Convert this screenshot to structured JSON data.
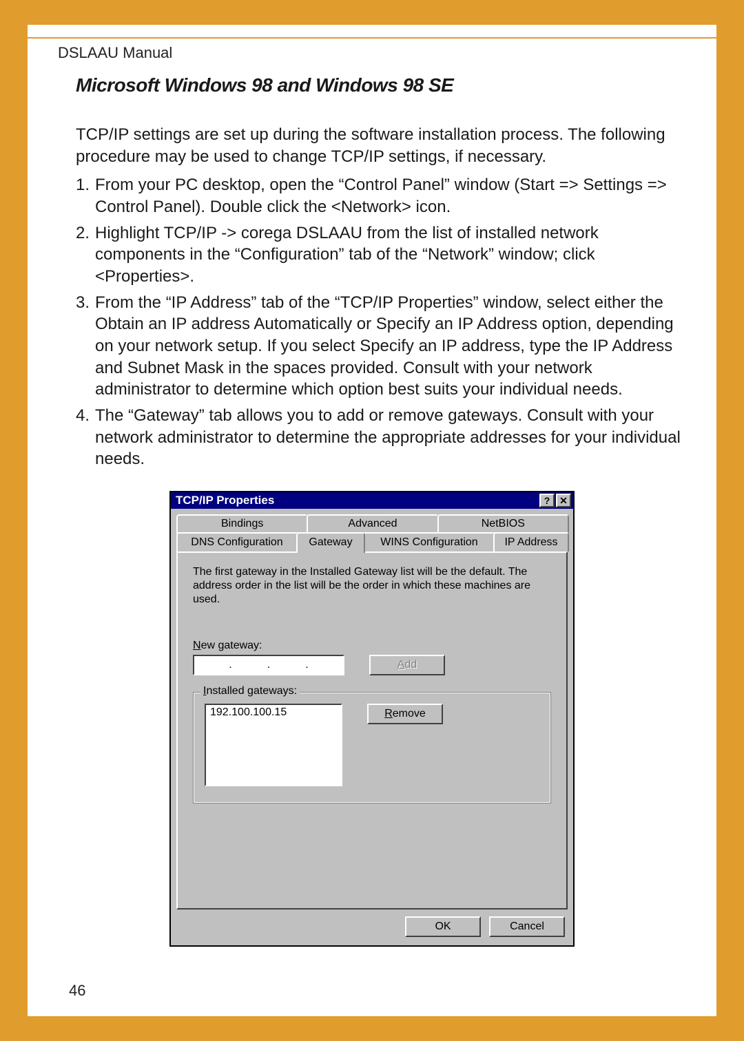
{
  "doc_header": "DSLAAU Manual",
  "section_title": "Microsoft Windows 98 and Windows 98 SE",
  "intro": "TCP/IP settings are set up during the software installation process. The following procedure may be used to change TCP/IP settings, if necessary.",
  "steps": [
    "From your PC desktop, open the “Control Panel” window (Start => Settings => Control Panel). Double click the <Network> icon.",
    "Highlight TCP/IP ->  corega DSLAAU from the list of installed network components in the “Configuration” tab of the “Network” window; click <Properties>.",
    "From the “IP Address” tab of the “TCP/IP Properties” window, select either the Obtain an IP address Automatically or Specify an IP Address option, depending on your network setup. If you select Specify an IP address, type the IP Address and Subnet Mask in the spaces provided. Consult with your network administrator to determine which option best suits your individual needs.",
    "The “Gateway” tab allows you to add or remove gateways. Consult with your network administrator to determine the appropriate addresses for your individual needs."
  ],
  "dialog": {
    "title": "TCP/IP Properties",
    "help_glyph": "?",
    "close_glyph": "✕",
    "tabs_back": [
      "Bindings",
      "Advanced",
      "NetBIOS"
    ],
    "tabs_front": [
      "DNS Configuration",
      "Gateway",
      "WINS Configuration",
      "IP Address"
    ],
    "active_tab": "Gateway",
    "help_text": "The first gateway in the Installed Gateway list will be the default. The address order in the list will be the order in which these machines are used.",
    "new_gateway_label": "New gateway:",
    "new_gateway_value": [
      "",
      "",
      "",
      ""
    ],
    "add_label": "Add",
    "installed_label": "Installed gateways:",
    "installed_items": [
      "192.100.100.15"
    ],
    "remove_label": "Remove",
    "ok_label": "OK",
    "cancel_label": "Cancel"
  },
  "page_number": "46"
}
